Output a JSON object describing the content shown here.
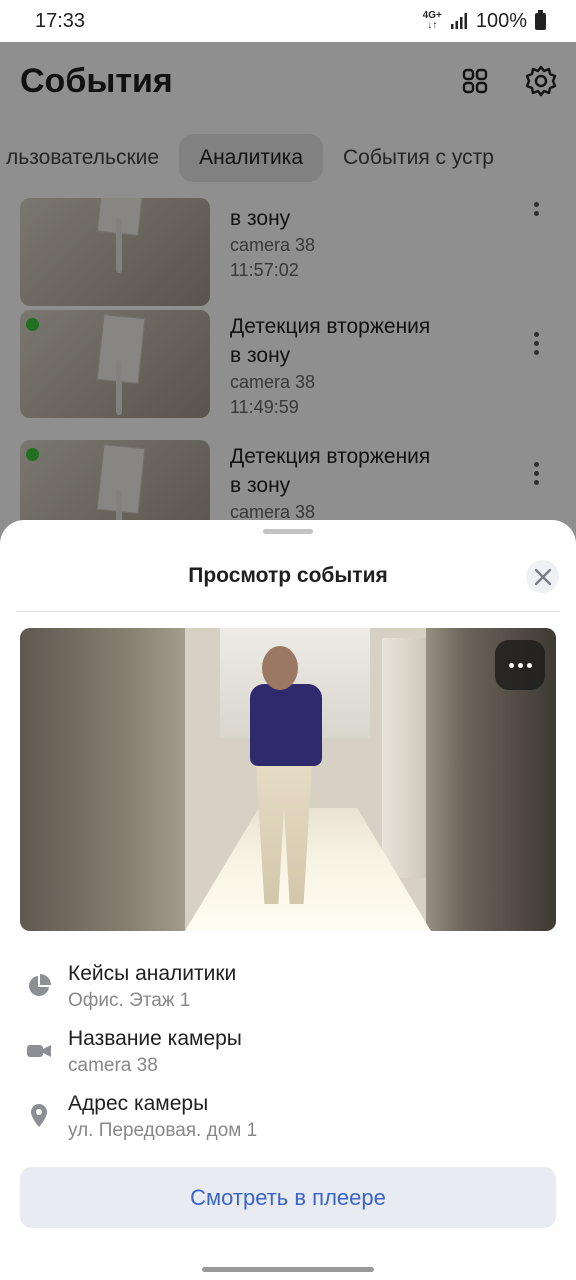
{
  "status_bar": {
    "time": "17:33",
    "network": "4G+",
    "battery": "100%"
  },
  "app": {
    "title": "События",
    "icons": [
      "grid-icon",
      "gear-icon"
    ],
    "tabs": [
      {
        "label": "льзовательские"
      },
      {
        "label": "Аналитика",
        "active": true
      },
      {
        "label": "События с устр"
      }
    ],
    "events": [
      {
        "title_line1": "",
        "title_line2": "в зону",
        "camera": "camera 38",
        "time": "11:57:02"
      },
      {
        "title_line1": "Детекция вторжения",
        "title_line2": "в зону",
        "camera": "camera 38",
        "time": "11:49:59"
      },
      {
        "title_line1": "Детекция вторжения",
        "title_line2": "в зону",
        "camera": "camera 38",
        "time": ""
      }
    ]
  },
  "sheet": {
    "title": "Просмотр события",
    "info": [
      {
        "icon": "pie-chart-icon",
        "label": "Кейсы аналитики",
        "value": "Офис. Этаж 1"
      },
      {
        "icon": "video-camera-icon",
        "label": "Название камеры",
        "value": "camera 38"
      },
      {
        "icon": "location-pin-icon",
        "label": "Адрес камеры",
        "value": "ул. Передовая. дом 1"
      }
    ],
    "play_button": "Смотреть в плеере"
  },
  "colors": {
    "accent": "#3a64c8",
    "button_bg": "#e8ebf2",
    "overlay": "rgba(0,0,0,0.44)"
  }
}
